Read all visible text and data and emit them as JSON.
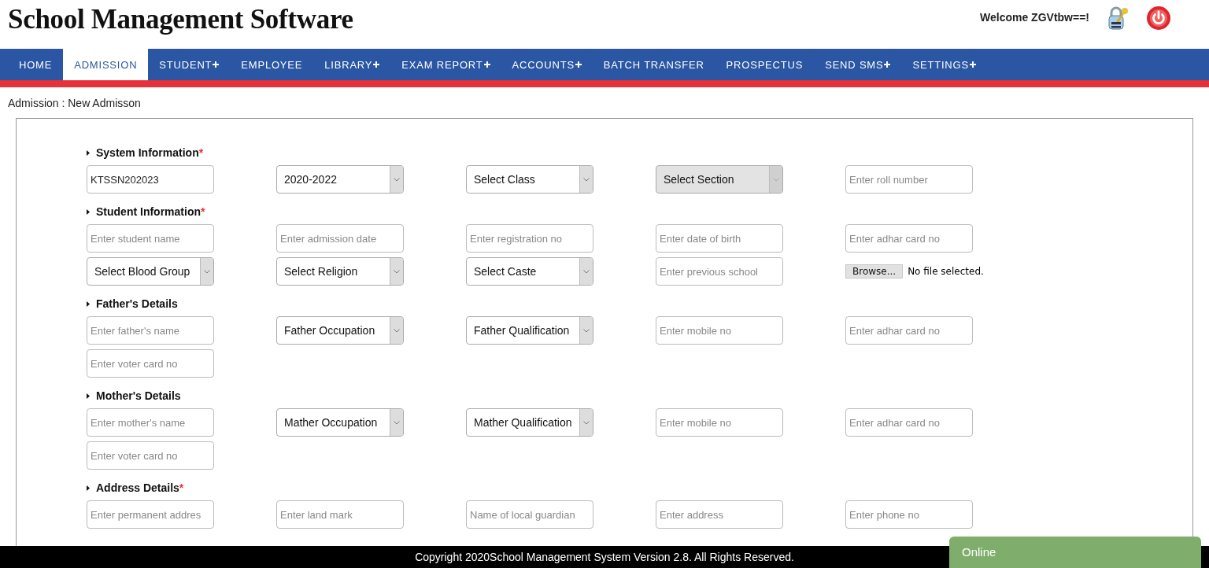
{
  "header": {
    "title": "School Management Software",
    "welcome": "Welcome ZGVtbw==!"
  },
  "nav": [
    {
      "label": "HOME",
      "selected": false,
      "submenu": false
    },
    {
      "label": "ADMISSION",
      "selected": true,
      "submenu": false
    },
    {
      "label": "STUDENT",
      "selected": false,
      "submenu": true
    },
    {
      "label": "EMPLOYEE",
      "selected": false,
      "submenu": false
    },
    {
      "label": "LIBRARY",
      "selected": false,
      "submenu": true
    },
    {
      "label": "EXAM REPORT",
      "selected": false,
      "submenu": true
    },
    {
      "label": "ACCOUNTS",
      "selected": false,
      "submenu": true
    },
    {
      "label": "BATCH TRANSFER",
      "selected": false,
      "submenu": false
    },
    {
      "label": "PROSPECTUS",
      "selected": false,
      "submenu": false
    },
    {
      "label": "SEND SMS",
      "selected": false,
      "submenu": true
    },
    {
      "label": "SETTINGS",
      "selected": false,
      "submenu": true
    }
  ],
  "breadcrumb": "Admission : New Admisson",
  "sections": [
    {
      "title": "System Information",
      "mark": "*",
      "rows": [
        [
          {
            "kind": "input",
            "value": "KTSSN202023"
          },
          {
            "kind": "select",
            "value": "2020-2022",
            "disabled": false
          },
          {
            "kind": "select",
            "value": "Select Class",
            "disabled": false
          },
          {
            "kind": "select",
            "value": "Select Section",
            "disabled": true
          },
          {
            "kind": "input",
            "placeholder": "Enter roll number"
          }
        ]
      ]
    },
    {
      "title": "Student Information",
      "mark": "*",
      "rows": [
        [
          {
            "kind": "input",
            "placeholder": "Enter student name"
          },
          {
            "kind": "input",
            "placeholder": "Enter admission date"
          },
          {
            "kind": "input",
            "placeholder": "Enter registration no"
          },
          {
            "kind": "input",
            "placeholder": "Enter date of birth"
          },
          {
            "kind": "input",
            "placeholder": "Enter adhar card no"
          }
        ],
        [
          {
            "kind": "select",
            "value": "Select Blood Group",
            "disabled": false
          },
          {
            "kind": "select",
            "value": "Select Religion",
            "disabled": false
          },
          {
            "kind": "select",
            "value": "Select Caste",
            "disabled": false
          },
          {
            "kind": "input",
            "placeholder": "Enter previous school"
          },
          {
            "kind": "file",
            "button": "Browse...",
            "status": "No file selected."
          }
        ]
      ]
    },
    {
      "title": "Father's Details",
      "rows": [
        [
          {
            "kind": "input",
            "placeholder": "Enter father's name"
          },
          {
            "kind": "select",
            "value": "Father Occupation",
            "disabled": false
          },
          {
            "kind": "select",
            "value": "Father Qualification",
            "disabled": false
          },
          {
            "kind": "input",
            "placeholder": "Enter mobile no"
          },
          {
            "kind": "input",
            "placeholder": "Enter adhar card no"
          }
        ],
        [
          {
            "kind": "input",
            "placeholder": "Enter voter card no"
          }
        ]
      ]
    },
    {
      "title": "Mother's Details",
      "rows": [
        [
          {
            "kind": "input",
            "placeholder": "Enter mother's name"
          },
          {
            "kind": "select",
            "value": "Mather Occupation",
            "disabled": false
          },
          {
            "kind": "select",
            "value": "Mather Qualification",
            "disabled": false
          },
          {
            "kind": "input",
            "placeholder": "Enter mobile no"
          },
          {
            "kind": "input",
            "placeholder": "Enter adhar card no"
          }
        ],
        [
          {
            "kind": "input",
            "placeholder": "Enter voter card no"
          }
        ]
      ]
    },
    {
      "title": "Address Details",
      "mark": "*",
      "rows": [
        [
          {
            "kind": "input",
            "placeholder": "Enter permanent addres"
          },
          {
            "kind": "input",
            "placeholder": "Enter land mark"
          },
          {
            "kind": "input",
            "placeholder": "Name of local guardian"
          },
          {
            "kind": "input",
            "placeholder": "Enter address"
          },
          {
            "kind": "input",
            "placeholder": "Enter phone no"
          }
        ]
      ]
    }
  ],
  "footer": "Copyright 2020School Management System Version 2.8. All Rights Reserved.",
  "chat": {
    "label": "Online"
  }
}
